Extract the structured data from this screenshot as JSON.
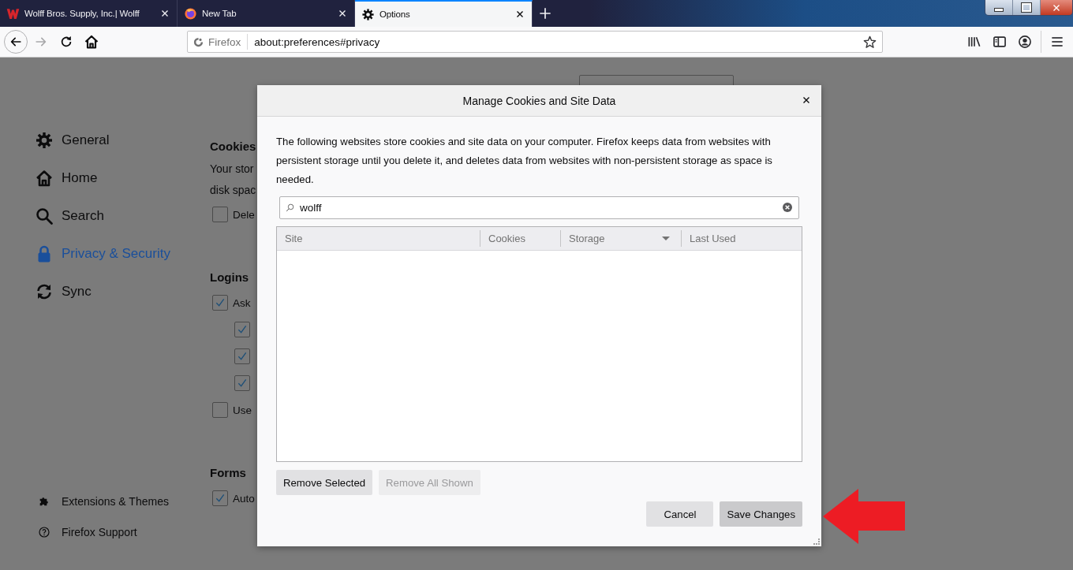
{
  "tabs": [
    {
      "title": "Wolff Bros. Supply, Inc.| Wolff",
      "kind": "site",
      "selected": false
    },
    {
      "title": "New Tab",
      "kind": "browser",
      "selected": false
    },
    {
      "title": "Options",
      "kind": "settings",
      "selected": true
    }
  ],
  "nav_buttons": [
    {
      "kind": "back",
      "disabled": false
    },
    {
      "kind": "forward",
      "disabled": true
    },
    {
      "kind": "reload",
      "disabled": false
    },
    {
      "kind": "home",
      "disabled": false
    }
  ],
  "url_bar": {
    "identity": "Firefox",
    "url": "about:preferences#privacy"
  },
  "toolbar_icons": [
    {
      "kind": "library"
    },
    {
      "kind": "sidebar"
    },
    {
      "kind": "account"
    },
    {
      "kind": "menu"
    }
  ],
  "sidebar": {
    "items": [
      {
        "label": "General",
        "kind": "gear",
        "selected": false
      },
      {
        "label": "Home",
        "kind": "home",
        "selected": false
      },
      {
        "label": "Search",
        "kind": "search",
        "selected": false
      },
      {
        "label": "Privacy & Security",
        "kind": "lock",
        "selected": true
      },
      {
        "label": "Sync",
        "kind": "sync",
        "selected": false
      }
    ],
    "footer_items": [
      {
        "label": "Extensions & Themes",
        "kind": "puzzle"
      },
      {
        "label": "Firefox Support",
        "kind": "help"
      }
    ]
  },
  "sections": [
    {
      "title": "Cookies",
      "items": [
        {
          "kind": "text",
          "text": "Your stor"
        },
        {
          "kind": "text",
          "text": "disk spac"
        },
        {
          "kind": "checkbox",
          "label": "Dele",
          "checked": false
        }
      ]
    },
    {
      "title": "Logins",
      "items": [
        {
          "kind": "checkbox",
          "label": "Ask",
          "checked": true,
          "children": [
            {
              "kind": "checkbox",
              "checked": true
            },
            {
              "kind": "checkbox",
              "checked": true
            },
            {
              "kind": "checkbox",
              "checked": true
            }
          ]
        },
        {
          "kind": "checkbox",
          "label": "Use",
          "checked": false
        }
      ]
    },
    {
      "title": "Forms",
      "items": [
        {
          "kind": "checkbox",
          "label": "Auto",
          "checked": true
        }
      ]
    }
  ],
  "dialog": {
    "title": "Manage Cookies and Site Data",
    "description": "The following websites store cookies and site data on your computer. Firefox keeps data from websites with persistent storage until you delete it, and deletes data from websites with non-persistent storage as space is needed.",
    "search": {
      "value": "wolff"
    },
    "columns": [
      {
        "label": "Site",
        "sorted": false
      },
      {
        "label": "Cookies",
        "sorted": false
      },
      {
        "label": "Storage",
        "sorted": true
      },
      {
        "label": "Last Used",
        "sorted": false
      }
    ],
    "list_buttons": [
      {
        "label": "Remove Selected",
        "disabled": false
      },
      {
        "label": "Remove All Shown",
        "disabled": true
      }
    ],
    "footer_buttons": [
      {
        "label": "Cancel",
        "focused": false
      },
      {
        "label": "Save Changes",
        "focused": true
      }
    ]
  }
}
